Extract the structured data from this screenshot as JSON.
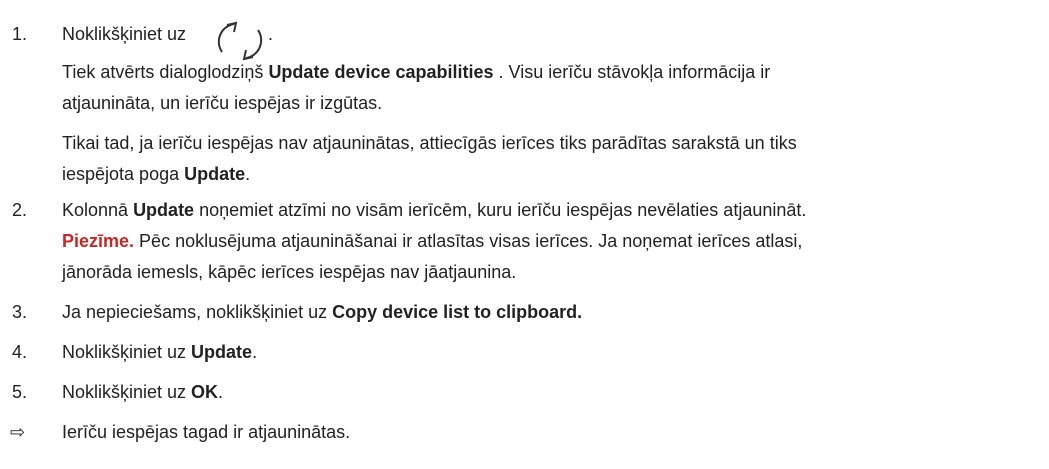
{
  "steps": [
    {
      "number": "1.",
      "prefix": "Noklikšķiniet uz",
      "suffix": ".",
      "icon": "refresh-icon",
      "lines": [
        {
          "pre": "Tiek atvērts dialoglodziņš ",
          "bold": "Update device capabilities",
          "post": " . Visu ierīču stāvokļa informācija ir"
        },
        {
          "text": "atjaunināta, un ierīču iespējas ir izgūtas."
        },
        {
          "text": "Tikai tad, ja ierīču iespējas nav atjauninātas, attiecīgās ierīces tiks parādītas sarakstā un tiks"
        },
        {
          "pre": "iespējota poga ",
          "bold": "Update",
          "post": "."
        }
      ]
    },
    {
      "number": "2.",
      "pre": "Kolonnā ",
      "bold": "Update",
      "post": " noņemiet atzīmi no visām ierīcēm, kuru ierīču iespējas nevēlaties atjaunināt.",
      "note_label": "Piezīme.",
      "note_line1": " Pēc noklusējuma atjaunināšanai ir atlasītas visas ierīces. Ja noņemat ierīces atlasi,",
      "note_line2": "jānorāda iemesls, kāpēc ierīces iespējas nav jāatjaunina."
    },
    {
      "number": "3.",
      "pre": "Ja nepieciešams, noklikšķiniet uz ",
      "bold": "Copy device list to clipboard.",
      "post": ""
    },
    {
      "number": "4.",
      "pre": "Noklikšķiniet uz ",
      "bold": "Update",
      "post": "."
    },
    {
      "number": "5.",
      "pre": "Noklikšķiniet uz ",
      "bold": "OK",
      "post": "."
    }
  ],
  "result": {
    "arrow": "⇨",
    "text": "Ierīču iespējas tagad ir atjauninātas."
  }
}
